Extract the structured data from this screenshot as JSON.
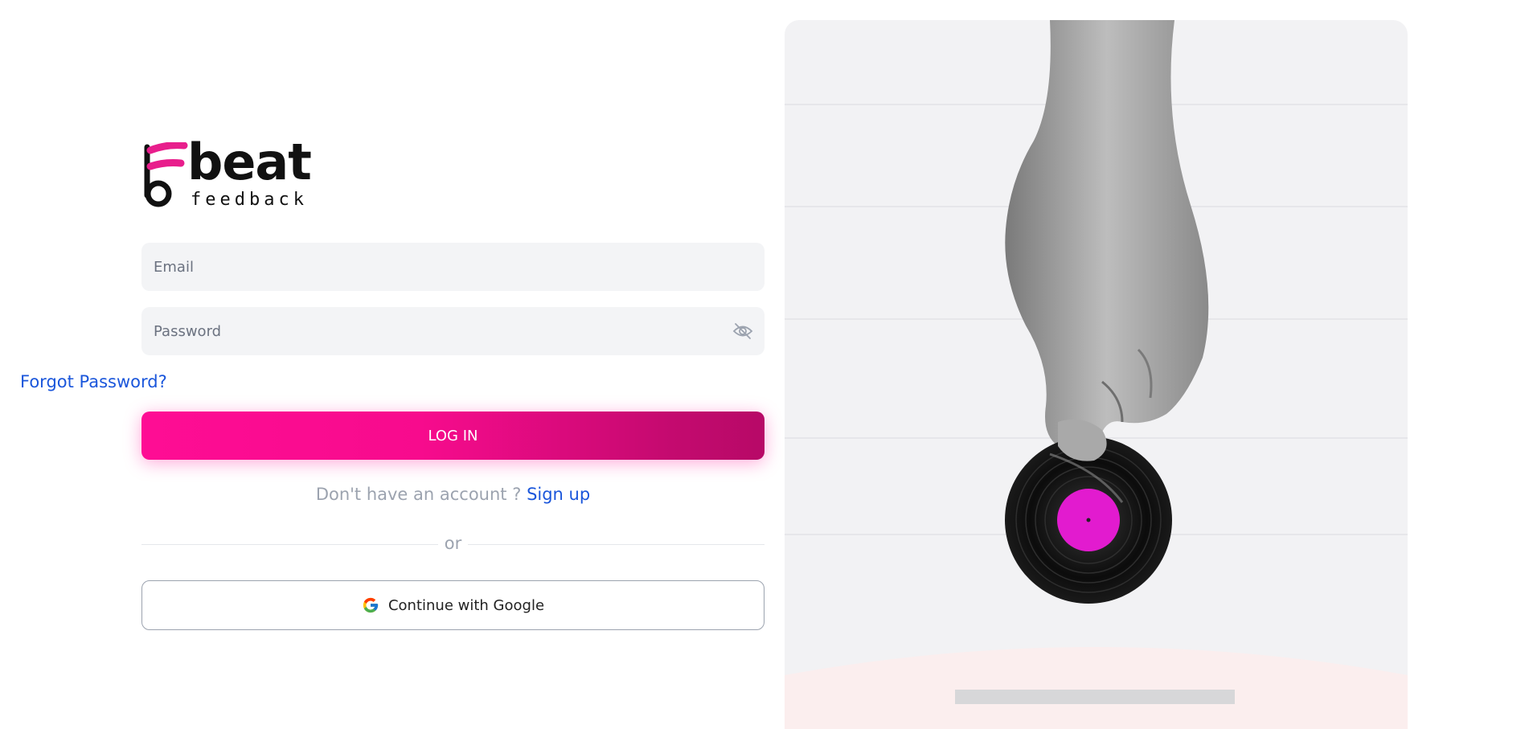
{
  "brand": {
    "logo_text_main": "beat",
    "logo_text_sub": "feedback",
    "accent_color": "#fe0d94",
    "link_color": "#1a56db"
  },
  "form": {
    "email_placeholder": "Email",
    "password_placeholder": "Password",
    "password_toggle_icon": "eye-off-icon",
    "forgot_password": "Forgot Password?",
    "login_label": "LOG IN",
    "no_account_text": "Don't have an account ?",
    "signup_link": "Sign up",
    "or_text": "or",
    "google_label": "Continue with Google",
    "google_icon": "google-icon"
  },
  "illustration": {
    "description_icon": "hand-holding-vinyl-record-illustration",
    "record_label_color": "#e21bcf"
  }
}
